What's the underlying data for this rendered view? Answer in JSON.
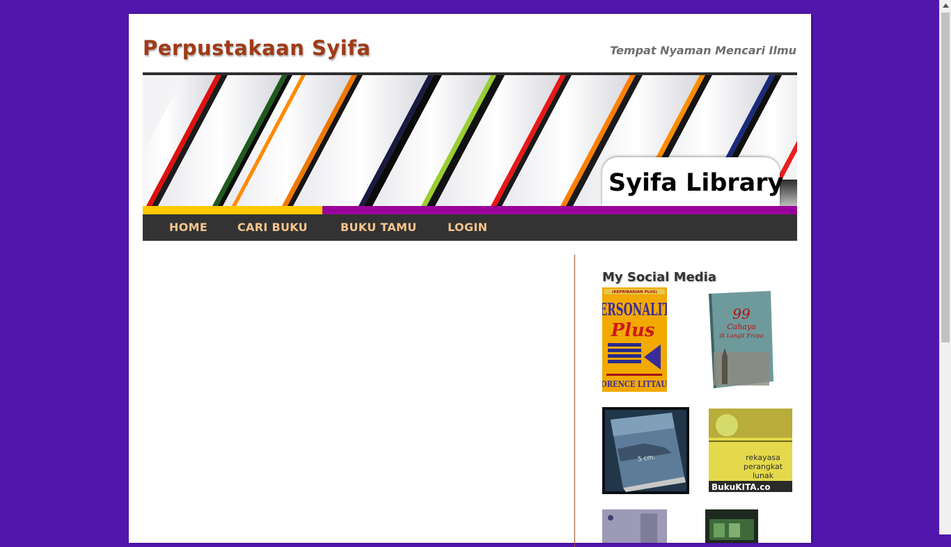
{
  "site": {
    "title": "Perpustakaan Syifa",
    "tagline": "Tempat Nyaman Mencari Ilmu"
  },
  "banner": {
    "badge_text": "Syifa Library"
  },
  "nav": {
    "items": [
      "HOME",
      "CARI BUKU",
      "BUKU TAMU",
      "LOGIN"
    ]
  },
  "sidebar": {
    "heading": "My Social Media",
    "book_covers": [
      {
        "title_lines": [
          "(KEPRIBADIAN PLUS)",
          "PERSONALITY",
          "Plus"
        ],
        "author": "FLORENCE LITTAUER"
      },
      {
        "title_lines": [
          "99",
          "Cahaya",
          "di Langit Eropa"
        ]
      },
      {
        "title": "5 cm."
      },
      {
        "title_lines": [
          "rekayasa",
          "perangkat",
          "lunak"
        ],
        "publisher": "BukuKITA.co"
      },
      {},
      {}
    ]
  },
  "colors": {
    "page_background": "#5117ad",
    "title": "#a03a16",
    "nav_background": "#333333",
    "nav_text": "#f7c58e",
    "banner_yellow": "#ffc800",
    "banner_purple": "#990099"
  }
}
